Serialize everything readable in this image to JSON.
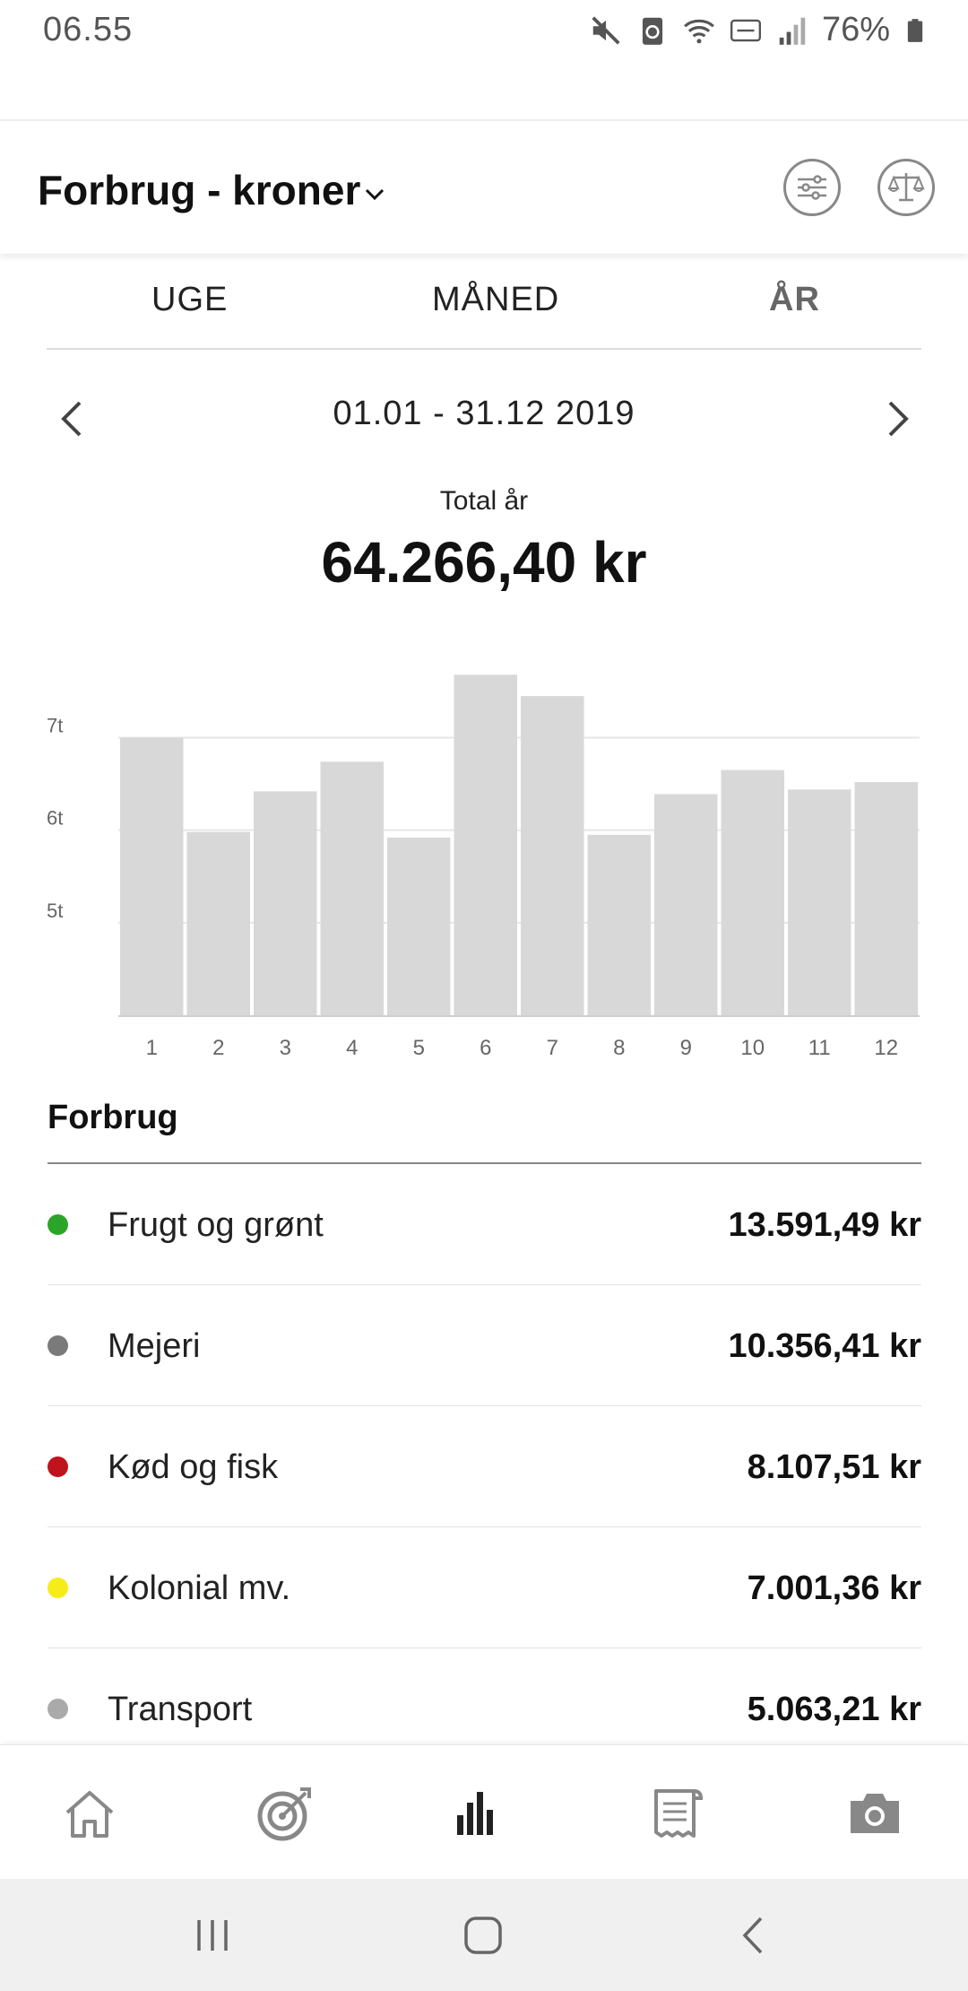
{
  "status_bar": {
    "time": "06.55",
    "battery": "76%",
    "icons": [
      "mute-icon",
      "sync-icon",
      "wifi-icon",
      "volte-icon",
      "signal-icon",
      "battery-icon"
    ]
  },
  "header": {
    "title": "Forbrug - kroner",
    "filter_icon": "sliders-icon",
    "compare_icon": "scale-icon"
  },
  "tabs": [
    {
      "label": "UGE",
      "active": false
    },
    {
      "label": "MÅNED",
      "active": false
    },
    {
      "label": "ÅR",
      "active": true
    }
  ],
  "period": {
    "range": "01.01 - 31.12 2019"
  },
  "total": {
    "label": "Total år",
    "value": "64.266,40 kr"
  },
  "chart_data": {
    "type": "bar",
    "categories": [
      "1",
      "2",
      "3",
      "4",
      "5",
      "6",
      "7",
      "8",
      "9",
      "10",
      "11",
      "12"
    ],
    "values": [
      7000,
      5980,
      6420,
      6740,
      5920,
      7680,
      7450,
      5950,
      6390,
      6650,
      6440,
      6520
    ],
    "ytick_labels": [
      {
        "value": 5000,
        "label": "5t"
      },
      {
        "value": 6000,
        "label": "6t"
      },
      {
        "value": 7000,
        "label": "7t"
      }
    ],
    "ylim": [
      4000,
      7800
    ],
    "grid": true,
    "bar_color": "#d8d8d8"
  },
  "breakdown": {
    "title": "Forbrug",
    "items": [
      {
        "label": "Frugt og grønt",
        "value": "13.591,49 kr",
        "color": "#2aa52a"
      },
      {
        "label": "Mejeri",
        "value": "10.356,41 kr",
        "color": "#7a7a7a"
      },
      {
        "label": "Kød og fisk",
        "value": "8.107,51 kr",
        "color": "#c0141c"
      },
      {
        "label": "Kolonial mv.",
        "value": "7.001,36 kr",
        "color": "#f5ec1a"
      },
      {
        "label": "Transport",
        "value": "5.063,21 kr",
        "color": "#aaaaaa"
      }
    ]
  },
  "bottom_nav": [
    {
      "name": "home-icon",
      "active": false
    },
    {
      "name": "target-icon",
      "active": false
    },
    {
      "name": "bar-chart-icon",
      "active": true
    },
    {
      "name": "receipt-icon",
      "active": false
    },
    {
      "name": "camera-icon",
      "active": false
    }
  ]
}
